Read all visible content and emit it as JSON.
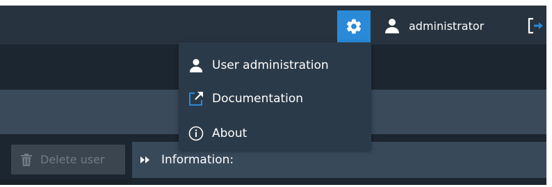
{
  "header": {
    "settings_icon": "gear-icon",
    "user_icon": "user-icon",
    "username": "administrator",
    "logout_icon": "logout-icon",
    "accent_color": "#2a8ad8"
  },
  "settings_menu": {
    "items": [
      {
        "label": "User administration",
        "icon": "user-icon"
      },
      {
        "label": "Documentation",
        "icon": "external-link-icon"
      },
      {
        "label": "About",
        "icon": "info-icon"
      }
    ]
  },
  "toolbar": {
    "delete_label": "Delete user",
    "delete_icon": "trash-icon"
  },
  "info_section": {
    "title": "Information:",
    "expand_icon": "double-chevron-right-icon"
  }
}
